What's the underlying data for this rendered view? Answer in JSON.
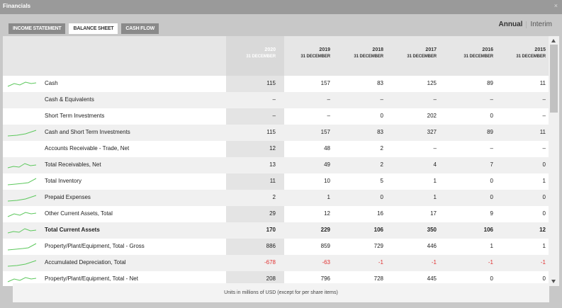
{
  "window": {
    "title": "Financials",
    "close_glyph": "×"
  },
  "tabs": [
    {
      "label": "INCOME STATEMENT",
      "active": false
    },
    {
      "label": "BALANCE SHEET",
      "active": true
    },
    {
      "label": "CASH FLOW",
      "active": false
    }
  ],
  "period_toggle": {
    "annual": "Annual",
    "interim": "Interim"
  },
  "columns": [
    {
      "year": "2020",
      "date": "31 DECEMBER"
    },
    {
      "year": "2019",
      "date": "31 DECEMBER"
    },
    {
      "year": "2018",
      "date": "31 DECEMBER"
    },
    {
      "year": "2017",
      "date": "31 DECEMBER"
    },
    {
      "year": "2016",
      "date": "31 DECEMBER"
    },
    {
      "year": "2015",
      "date": "31 DECEMBER"
    }
  ],
  "rows": [
    {
      "label": "Cash",
      "spark": true,
      "bold": false,
      "values": [
        "115",
        "157",
        "83",
        "125",
        "89",
        "11"
      ]
    },
    {
      "label": "Cash & Equivalents",
      "spark": false,
      "bold": false,
      "values": [
        "–",
        "–",
        "–",
        "–",
        "–",
        "–"
      ]
    },
    {
      "label": "Short Term Investments",
      "spark": false,
      "bold": false,
      "values": [
        "–",
        "–",
        "0",
        "202",
        "0",
        "–"
      ]
    },
    {
      "label": "Cash and Short Term Investments",
      "spark": true,
      "bold": false,
      "values": [
        "115",
        "157",
        "83",
        "327",
        "89",
        "11"
      ]
    },
    {
      "label": "Accounts Receivable - Trade, Net",
      "spark": false,
      "bold": false,
      "values": [
        "12",
        "48",
        "2",
        "–",
        "–",
        "–"
      ]
    },
    {
      "label": "Total Receivables, Net",
      "spark": true,
      "bold": false,
      "values": [
        "13",
        "49",
        "2",
        "4",
        "7",
        "0"
      ]
    },
    {
      "label": "Total Inventory",
      "spark": true,
      "bold": false,
      "values": [
        "11",
        "10",
        "5",
        "1",
        "0",
        "1"
      ]
    },
    {
      "label": "Prepaid Expenses",
      "spark": true,
      "bold": false,
      "values": [
        "2",
        "1",
        "0",
        "1",
        "0",
        "0"
      ]
    },
    {
      "label": "Other Current Assets, Total",
      "spark": true,
      "bold": false,
      "values": [
        "29",
        "12",
        "16",
        "17",
        "9",
        "0"
      ]
    },
    {
      "label": "Total Current Assets",
      "spark": true,
      "bold": true,
      "values": [
        "170",
        "229",
        "106",
        "350",
        "106",
        "12"
      ]
    },
    {
      "label": "Property/Plant/Equipment, Total - Gross",
      "spark": true,
      "bold": false,
      "values": [
        "886",
        "859",
        "729",
        "446",
        "1",
        "1"
      ]
    },
    {
      "label": "Accumulated Depreciation, Total",
      "spark": true,
      "bold": false,
      "values": [
        "-678",
        "-63",
        "-1",
        "-1",
        "-1",
        "-1"
      ]
    },
    {
      "label": "Property/Plant/Equipment, Total - Net",
      "spark": true,
      "bold": false,
      "values": [
        "208",
        "796",
        "728",
        "445",
        "0",
        "0"
      ]
    }
  ],
  "footer": {
    "note": "Units in millions of USD (except for per share items)"
  },
  "colors": {
    "sparkline": "#5cc85c",
    "negative": "#e03131",
    "tab_inactive": "#8a8a8a",
    "header_bg": "#e6e6e6"
  },
  "icons": {
    "scroll_up": "triangle-up-icon",
    "scroll_down": "triangle-down-icon",
    "close": "close-icon"
  }
}
